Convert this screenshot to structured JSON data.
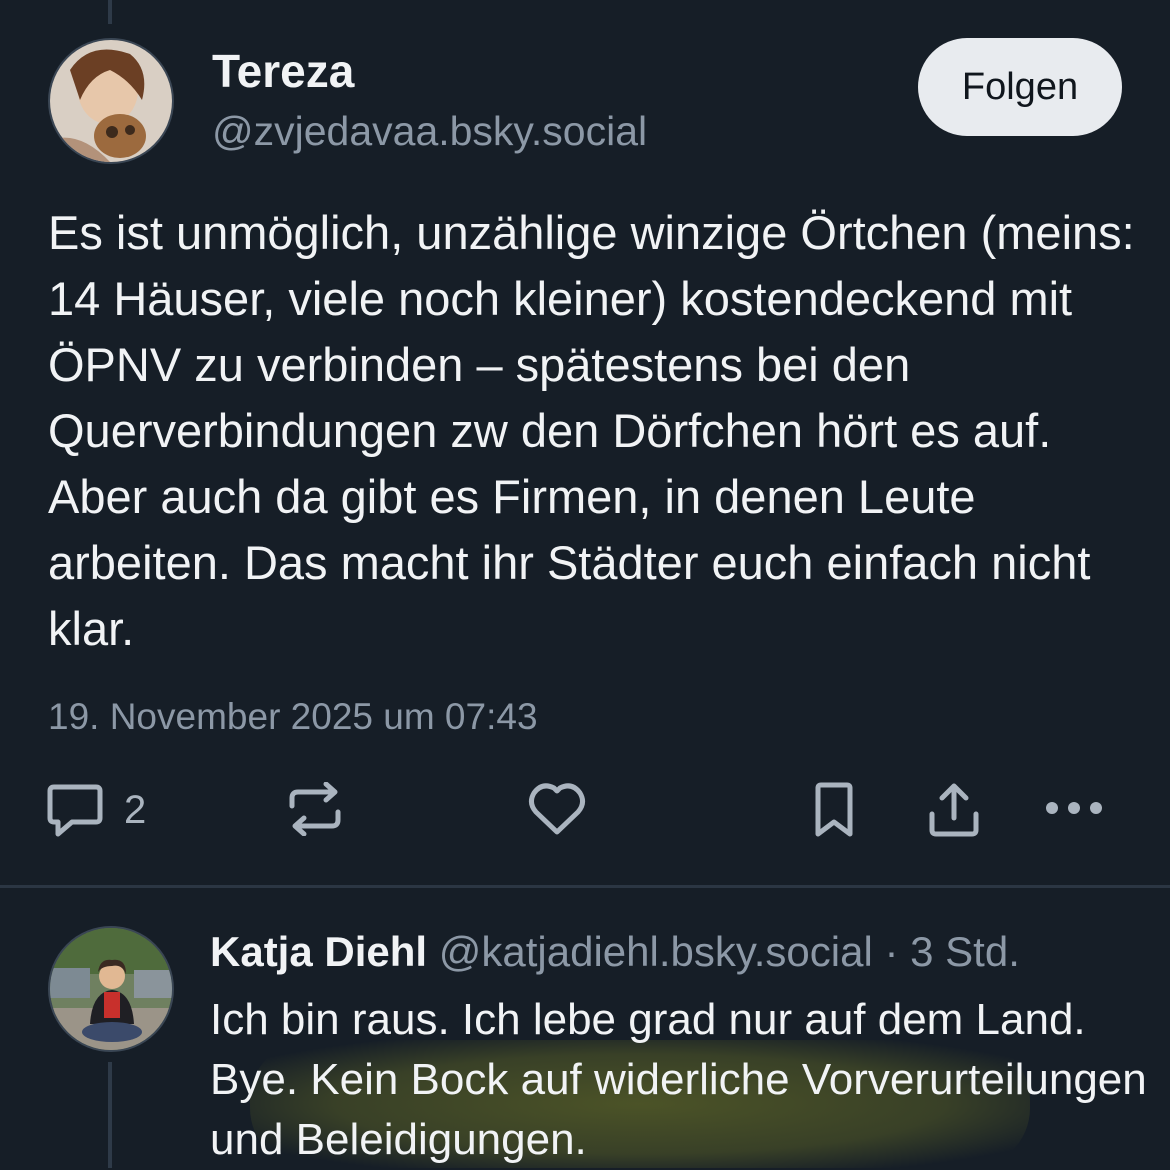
{
  "post": {
    "author_name": "Tereza",
    "author_handle": "@zvjedavaa.bsky.social",
    "follow_label": "Folgen",
    "text": "Es ist unmöglich, unzählige winzige Örtchen (meins: 14 Häuser, viele noch kleiner) kostendeckend mit ÖPNV zu verbinden – spätestens bei den Querverbindungen zw den Dörfchen hört es auf. Aber auch da gibt es Firmen, in denen Leute arbeiten. Das macht ihr Städter euch einfach nicht klar.",
    "timestamp": "19. November 2025 um 07:43",
    "reply_count": "2",
    "actions": [
      "reply-icon",
      "repost-icon",
      "like-icon",
      "bookmark-icon",
      "share-icon",
      "more-icon"
    ]
  },
  "reply": {
    "author_name": "Katja Diehl",
    "author_handle": "@katjadiehl.bsky.social",
    "separator": "·",
    "time_ago": "3 Std.",
    "text": "Ich bin raus. Ich lebe grad nur auf dem Land. Bye. Kein Bock auf widerliche Vorverurteilungen und Beleidigungen.",
    "highlight_color": "#d6dc28"
  },
  "colors": {
    "background": "#161e27",
    "text": "#f1f3f5",
    "muted": "#8c98a6",
    "follow_bg": "#e8ebef"
  }
}
